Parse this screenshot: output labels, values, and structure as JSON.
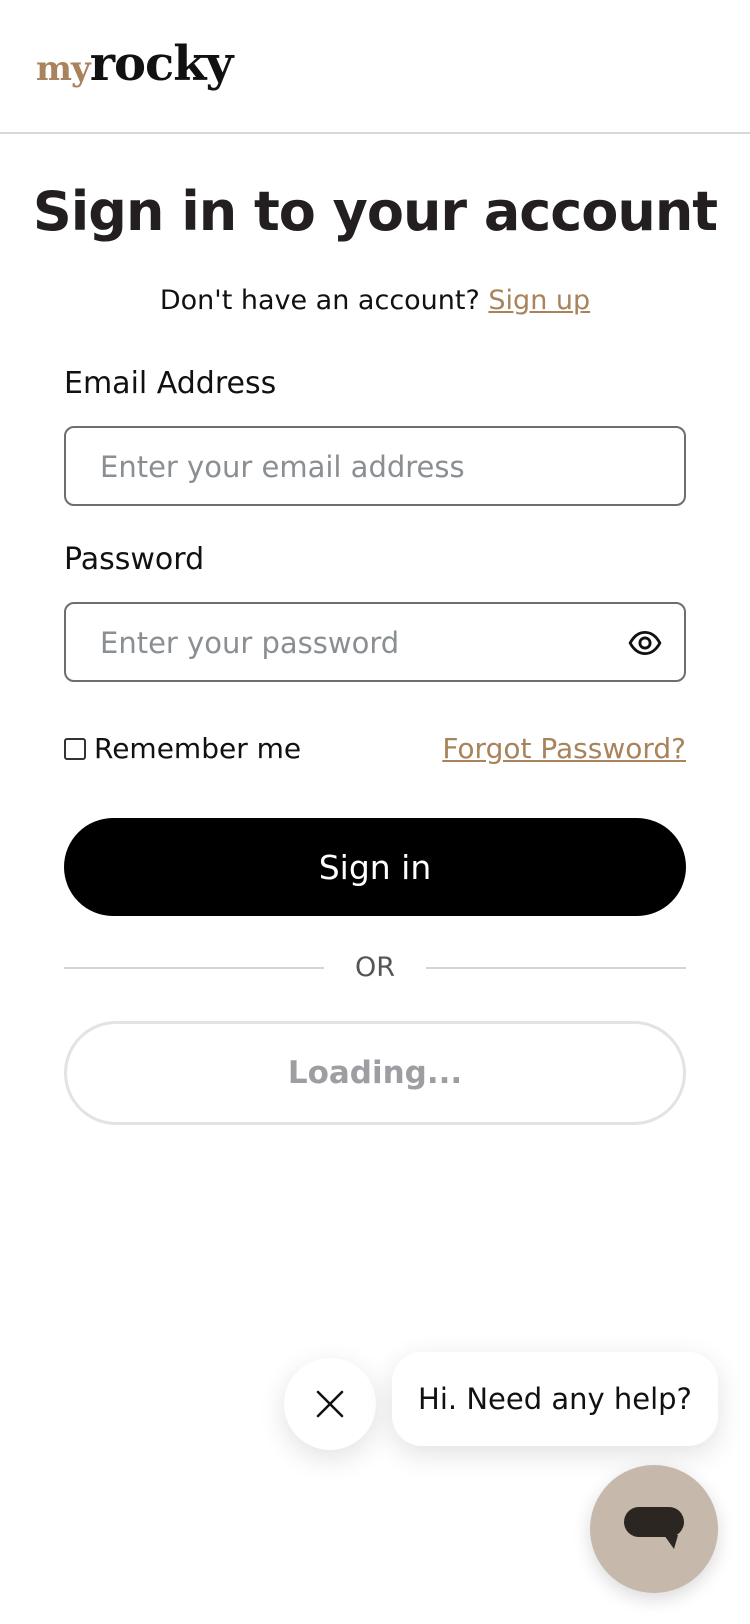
{
  "header": {
    "logo_prefix": "my",
    "logo_name": "rocky"
  },
  "page": {
    "title": "Sign in to your account",
    "subtitle": "Don't have an account?",
    "signup_link": "Sign up"
  },
  "form": {
    "email_label": "Email Address",
    "email_placeholder": "Enter your email address",
    "email_value": "",
    "password_label": "Password",
    "password_placeholder": "Enter your password",
    "password_value": "",
    "password_toggle_icon": "eye-icon",
    "remember_label": "Remember me",
    "remember_checked": false,
    "forgot_link": "Forgot Password?"
  },
  "actions": {
    "signin_label": "Sign in",
    "divider_label": "OR",
    "loading_label": "Loading..."
  },
  "chat": {
    "greeting": "Hi. Need any help?",
    "close_icon": "close-icon",
    "launcher_icon": "chat-icon"
  },
  "colors": {
    "accent": "#a8835b",
    "primary_button": "#000000",
    "chat_launcher": "#c6b9ab"
  }
}
